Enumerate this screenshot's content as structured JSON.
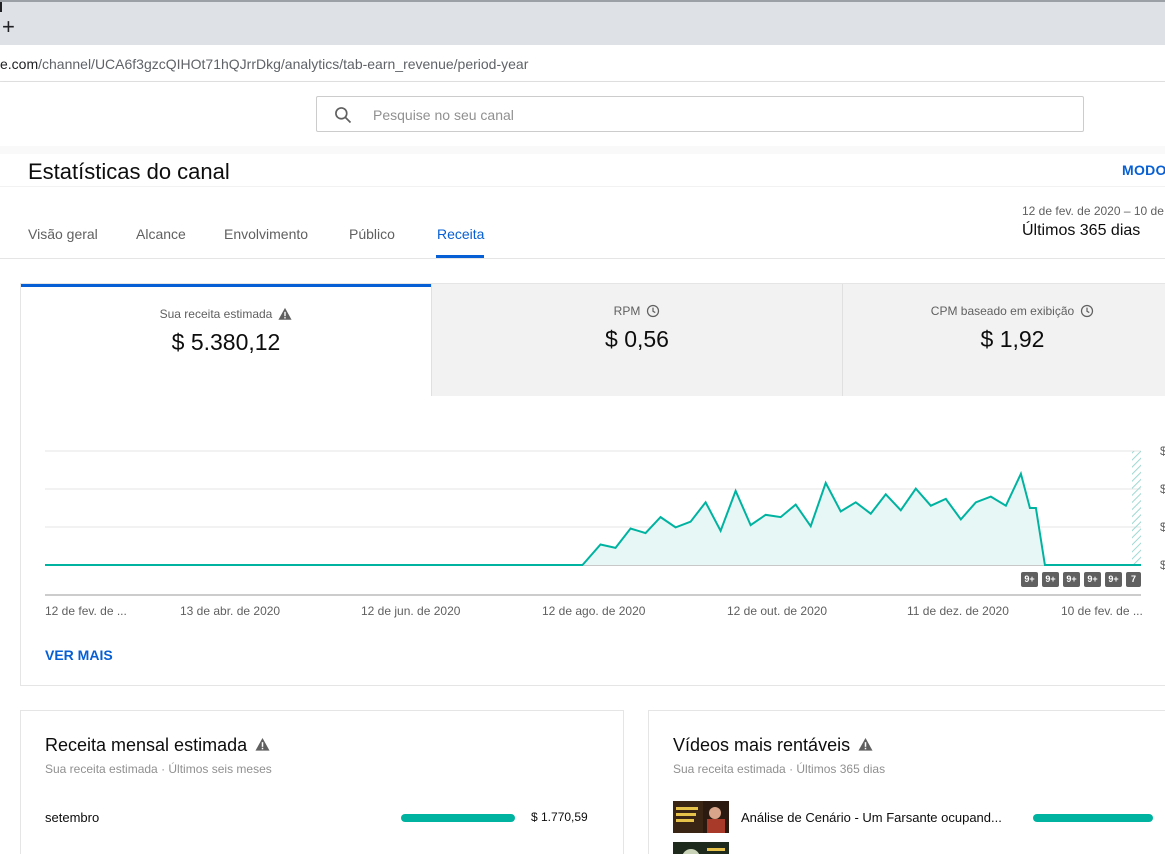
{
  "browser": {
    "new_tab_glyph": "+",
    "url_host": "e.com",
    "url_path": "/channel/UCA6f3gzcQIHOt71hQJrrDkg/analytics/tab-earn_revenue/period-year"
  },
  "header": {
    "search_placeholder": "Pesquise no seu canal",
    "search_icon": "search-icon"
  },
  "page": {
    "title": "Estatísticas do canal",
    "mode_button": "MODO"
  },
  "tabs": [
    {
      "label": "Visão geral"
    },
    {
      "label": "Alcance"
    },
    {
      "label": "Envolvimento"
    },
    {
      "label": "Público"
    },
    {
      "label": "Receita",
      "active": true
    }
  ],
  "period": {
    "range": "12 de fev. de 2020 – 10 de",
    "label": "Últimos 365 dias"
  },
  "metrics": [
    {
      "label": "Sua receita estimada",
      "value": "$ 5.380,12",
      "icon": "warning-icon"
    },
    {
      "label": "RPM",
      "value": "$ 0,56",
      "icon": "clock-icon"
    },
    {
      "label": "CPM baseado em exibição",
      "value": "$ 1,92",
      "icon": "clock-icon"
    }
  ],
  "chart_data": {
    "type": "area",
    "title": "",
    "xlabel": "",
    "ylabel": "",
    "x_tick_labels": [
      "12 de fev. de ...",
      "13 de abr. de 2020",
      "12 de jun. de 2020",
      "12 de ago. de 2020",
      "12 de out. de 2020",
      "11 de dez. de 2020",
      "10 de fev. de ..."
    ],
    "y_tick_labels": [
      "$",
      "$",
      "$",
      "$"
    ],
    "y_ticks_relative": [
      0,
      0.333,
      0.667,
      1.0
    ],
    "grid": true,
    "color": "#00b3a1",
    "fill_color": "#e6f7f5",
    "series": [
      {
        "x_day": [
          0,
          179,
          185,
          190,
          195,
          200,
          205,
          210,
          215,
          220,
          225,
          230,
          235,
          240,
          245,
          250,
          255,
          260,
          265,
          270,
          275,
          280,
          285,
          290,
          295,
          300,
          305,
          310,
          315,
          320,
          325,
          328,
          330,
          333,
          365
        ],
        "y_relative": [
          0,
          0,
          0.18,
          0.15,
          0.32,
          0.28,
          0.42,
          0.33,
          0.38,
          0.55,
          0.3,
          0.65,
          0.35,
          0.44,
          0.42,
          0.53,
          0.34,
          0.72,
          0.47,
          0.55,
          0.45,
          0.62,
          0.48,
          0.67,
          0.52,
          0.58,
          0.4,
          0.55,
          0.6,
          0.52,
          0.8,
          0.5,
          0.5,
          0,
          0
        ]
      }
    ],
    "annotations": [
      "9+",
      "9+",
      "9+",
      "9+",
      "9+",
      "7"
    ]
  },
  "see_more": "VER MAIS",
  "monthly_card": {
    "title": "Receita mensal estimada",
    "subtitle": "Sua receita estimada · Últimos seis meses",
    "rows": [
      {
        "label": "setembro",
        "value": "$ 1.770,59",
        "fraction": 0.82
      }
    ]
  },
  "videos_card": {
    "title": "Vídeos mais rentáveis",
    "subtitle": "Sua receita estimada · Últimos 365 dias",
    "rows": [
      {
        "label": "Análise de Cenário - Um Farsante ocupand...",
        "fraction": 1.0
      }
    ]
  }
}
